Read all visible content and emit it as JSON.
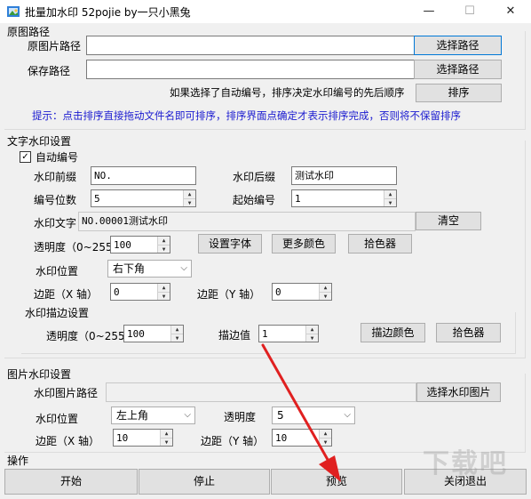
{
  "window": {
    "title": "批量加水印 52pojie by一只小黑兔",
    "minimize": "—",
    "maximize": "☐",
    "close": "✕"
  },
  "source": {
    "section_label": "原图路径",
    "src_label": "原图片路径",
    "src_value": "",
    "src_button": "选择路径",
    "save_label": "保存路径",
    "save_value": "",
    "save_button": "选择路径",
    "sort_note": "如果选择了自动编号，排序决定水印编号的先后顺序",
    "sort_button": "排序",
    "tip": "提示：点击排序直接拖动文件名即可排序，排序界面点确定才表示排序完成，否则将不保留排序"
  },
  "text_wm": {
    "section_label": "文字水印设置",
    "auto_number_label": "自动编号",
    "auto_number_checked": true,
    "prefix_label": "水印前缀",
    "prefix_value": "NO.",
    "suffix_label": "水印后缀",
    "suffix_value": "测试水印",
    "digits_label": "编号位数",
    "digits_value": "5",
    "start_label": "起始编号",
    "start_value": "1",
    "text_label": "水印文字",
    "text_value": "NO.00001测试水印",
    "clear_button": "清空",
    "opacity_label": "透明度（0~255）",
    "opacity_value": "100",
    "font_button": "设置字体",
    "more_color_button": "更多颜色",
    "picker_button": "拾色器",
    "position_label": "水印位置",
    "position_value": "右下角",
    "margin_x_label": "边距（X 轴）",
    "margin_x_value": "0",
    "margin_y_label": "边距（Y 轴）",
    "margin_y_value": "0"
  },
  "stroke": {
    "section_label": "水印描边设置",
    "opacity_label": "透明度（0~255）",
    "opacity_value": "100",
    "value_label": "描边值",
    "value_value": "1",
    "color_button": "描边颜色",
    "picker_button": "拾色器"
  },
  "image_wm": {
    "section_label": "图片水印设置",
    "path_label": "水印图片路径",
    "path_value": "",
    "path_button": "选择水印图片",
    "position_label": "水印位置",
    "position_value": "左上角",
    "opacity_label": "透明度",
    "opacity_value": "5",
    "margin_x_label": "边距（X 轴）",
    "margin_x_value": "10",
    "margin_y_label": "边距（Y 轴）",
    "margin_y_value": "10"
  },
  "actions": {
    "section_label": "操作",
    "start": "开始",
    "stop": "停止",
    "preview": "预览",
    "exit": "关闭退出"
  },
  "colors": {
    "annotation_arrow": "#e02020",
    "hint_text": "#1a1ad0",
    "focus_border": "#0078d7"
  },
  "watermark": "下载吧"
}
